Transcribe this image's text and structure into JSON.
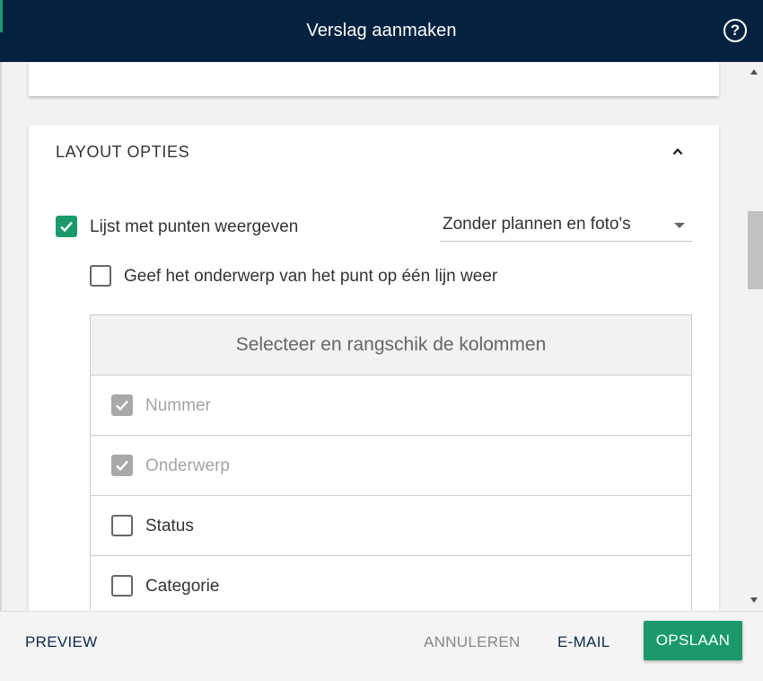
{
  "dialog": {
    "title": "Verslag aanmaken"
  },
  "layout_options": {
    "section_title": "LAYOUT OPTIES",
    "show_points_list": {
      "label": "Lijst met punten weergeven",
      "checked": true
    },
    "points_dropdown": {
      "selected": "Zonder plannen en foto's"
    },
    "single_line_subject": {
      "label": "Geef het onderwerp van het punt op één lijn weer",
      "checked": false
    },
    "columns": {
      "header": "Selecteer en rangschik de kolommen",
      "items": [
        {
          "label": "Nummer",
          "checked": true,
          "disabled": true
        },
        {
          "label": "Onderwerp",
          "checked": true,
          "disabled": true
        },
        {
          "label": "Status",
          "checked": false,
          "disabled": false
        },
        {
          "label": "Categorie",
          "checked": false,
          "disabled": false
        }
      ]
    }
  },
  "footer": {
    "preview": "PREVIEW",
    "cancel": "ANNULEREN",
    "email": "E-MAIL",
    "save": "OPSLAAN"
  },
  "colors": {
    "header_bg": "#03223f",
    "accent": "#1a9a6a"
  },
  "icons": {
    "help": "help-circle-icon",
    "collapse": "chevron-up-icon",
    "checkmark": "check-icon",
    "dropdown": "caret-down-icon"
  }
}
